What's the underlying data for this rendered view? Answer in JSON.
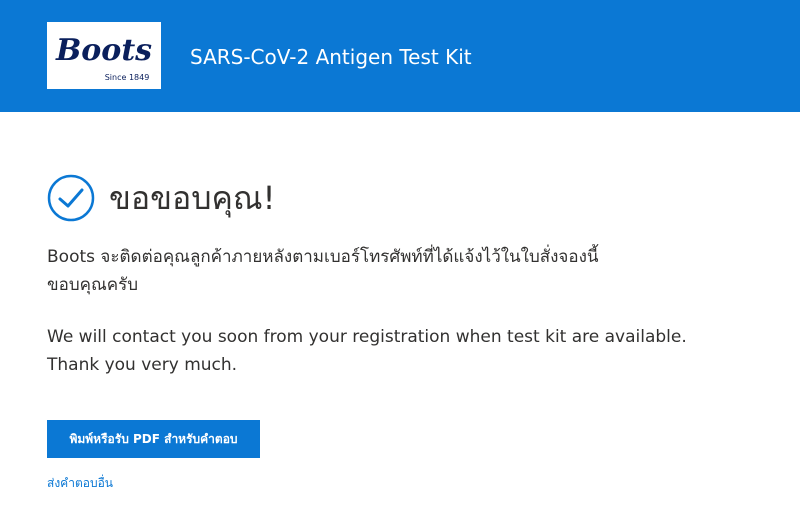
{
  "header": {
    "logo": {
      "wordmark": "Boots",
      "tagline": "Since 1849"
    },
    "title": "SARS-CoV-2 Antigen Test Kit"
  },
  "confirmation": {
    "icon": "check-circle-icon",
    "heading": "ขอขอบคุณ!",
    "message_th_line1": "Boots จะติดต่อคุณลูกค้าภายหลังตามเบอร์โทรศัพท์ที่ได้แจ้งไว้ในใบสั่งจองนี้",
    "message_th_line2": "ขอบคุณครับ",
    "message_en_line1": "We will contact you soon from your registration when test kit are available.",
    "message_en_line2": "Thank you very much."
  },
  "actions": {
    "print_pdf_label": "พิมพ์หรือรับ PDF สำหรับคำตอบ",
    "submit_another_label": "ส่งคำตอบอื่น"
  },
  "colors": {
    "brand_blue": "#0b78d4",
    "logo_navy": "#0a1f5c",
    "text": "#323130"
  }
}
